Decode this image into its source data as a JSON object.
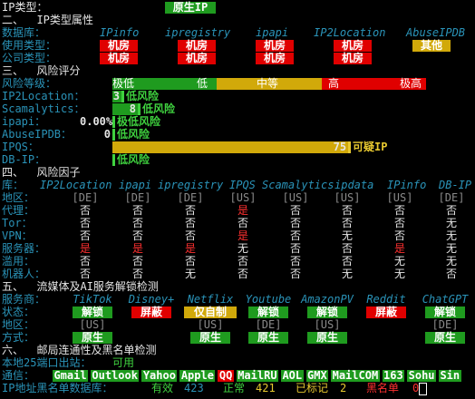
{
  "ip_type": {
    "label": "IP类型：",
    "value": "原生IP"
  },
  "section2": {
    "title": "二、  IP类型属性"
  },
  "attrs": {
    "db_label": "数据库：",
    "use_label": "使用类型：",
    "company_label": "公司类型：",
    "dbs": [
      "IPinfo",
      "ipregistry",
      "ipapi",
      "IP2Location",
      "AbuseIPDB"
    ],
    "use_values": [
      "机房",
      "机房",
      "机房",
      "机房",
      "其他"
    ],
    "company_values": [
      "机房",
      "机房",
      "机房",
      "机房"
    ]
  },
  "section3": {
    "title": "三、  风险评分"
  },
  "risk_scale": {
    "label": "风险等级：",
    "levels": [
      "极低",
      "低",
      "中等",
      "高",
      "极高"
    ]
  },
  "risk_scores": [
    {
      "name": "IP2Location：",
      "score": "3",
      "text": "低风险",
      "fraction": 0.03,
      "color": "green"
    },
    {
      "name": "Scamalytics：",
      "score": "8",
      "text": "低风险",
      "fraction": 0.08,
      "color": "green"
    },
    {
      "name": "ipapi：",
      "score": "0.00%",
      "text": "极低风险",
      "fraction": 0.0,
      "color": "green"
    },
    {
      "name": "AbuseIPDB：",
      "score": "0",
      "text": "低风险",
      "fraction": 0.0,
      "color": "green"
    },
    {
      "name": "IPQS：",
      "score": "75",
      "text": "可疑IP",
      "fraction": 0.75,
      "color": "yellow"
    },
    {
      "name": "DB-IP：",
      "score": "",
      "text": "低风险",
      "fraction": 0.0,
      "color": "green"
    }
  ],
  "section4": {
    "title": "四、  风险因子"
  },
  "factors": {
    "lib_label": "库：",
    "libs": [
      "IP2Location",
      "ipapi",
      "ipregistry",
      "IPQS",
      "Scamalytics",
      "ipdata",
      "IPinfo",
      "DB-IP"
    ],
    "rows": [
      {
        "label": "地区：",
        "values": [
          "[DE]",
          "[DE]",
          "[DE]",
          "[US]",
          "[US]",
          "[US]",
          "[US]",
          "[DE]"
        ],
        "colors": [
          "gray",
          "gray",
          "gray",
          "gray",
          "gray",
          "gray",
          "gray",
          "gray"
        ]
      },
      {
        "label": "代理：",
        "values": [
          "否",
          "否",
          "否",
          "是",
          "否",
          "否",
          "否",
          "否"
        ],
        "colors": [
          "white",
          "white",
          "white",
          "red",
          "white",
          "white",
          "white",
          "white"
        ]
      },
      {
        "label": "Tor：",
        "values": [
          "否",
          "否",
          "否",
          "否",
          "否",
          "否",
          "否",
          "无"
        ],
        "colors": [
          "white",
          "white",
          "white",
          "white",
          "white",
          "white",
          "white",
          "white"
        ]
      },
      {
        "label": "VPN：",
        "values": [
          "否",
          "否",
          "否",
          "是",
          "否",
          "无",
          "否",
          "无"
        ],
        "colors": [
          "white",
          "white",
          "white",
          "red",
          "white",
          "white",
          "white",
          "white"
        ]
      },
      {
        "label": "服务器：",
        "values": [
          "是",
          "是",
          "是",
          "无",
          "否",
          "否",
          "是",
          "无"
        ],
        "colors": [
          "red",
          "red",
          "red",
          "white",
          "white",
          "white",
          "red",
          "white"
        ]
      },
      {
        "label": "滥用：",
        "values": [
          "否",
          "否",
          "否",
          "否",
          "否",
          "否",
          "无",
          "无"
        ],
        "colors": [
          "white",
          "white",
          "white",
          "white",
          "white",
          "white",
          "white",
          "white"
        ]
      },
      {
        "label": "机器人：",
        "values": [
          "否",
          "否",
          "无",
          "否",
          "否",
          "无",
          "无",
          "否"
        ],
        "colors": [
          "white",
          "white",
          "white",
          "white",
          "white",
          "white",
          "white",
          "white"
        ]
      }
    ]
  },
  "section5": {
    "title": "五、  流媒体及AI服务解锁检测"
  },
  "streaming": {
    "service_label": "服务商：",
    "status_label": "状态：",
    "region_label": "地区：",
    "method_label": "方式：",
    "services": [
      "TikTok",
      "Disney+",
      "Netflix",
      "Youtube",
      "AmazonPV",
      "Reddit",
      "ChatGPT"
    ],
    "status": [
      "解锁",
      "屏蔽",
      "仅自制",
      "解锁",
      "解锁",
      "屏蔽",
      "解锁"
    ],
    "status_colors": [
      "green",
      "red",
      "yellow",
      "green",
      "green",
      "red",
      "green"
    ],
    "regions": [
      "[US]",
      "",
      "[US]",
      "[DE]",
      "[US]",
      "",
      "[DE]"
    ],
    "methods": [
      "原生",
      "",
      "原生",
      "原生",
      "原生",
      "",
      "原生"
    ]
  },
  "section6": {
    "title": "六、  邮局连通性及黑名单检测"
  },
  "mail": {
    "port_label": "本地25端口出站：",
    "port_value": "可用",
    "comm_label": "通信：",
    "services": [
      "Gmail",
      "Outlook",
      "Yahoo",
      "Apple",
      "QQ",
      "MailRU",
      "AOL",
      "GMX",
      "MailCOM",
      "163",
      "Sohu",
      "Sin"
    ],
    "service_colors": [
      "green",
      "green",
      "green",
      "green",
      "red",
      "green",
      "green",
      "green",
      "green",
      "green",
      "green",
      "green"
    ]
  },
  "blacklist": {
    "label": "IP地址黑名单数据库：",
    "valid_label": "有效",
    "valid": "423",
    "normal_label": "正常",
    "normal": "421",
    "marked_label": "已标记",
    "marked": "2",
    "black_label": "黑名单",
    "black": "0"
  }
}
